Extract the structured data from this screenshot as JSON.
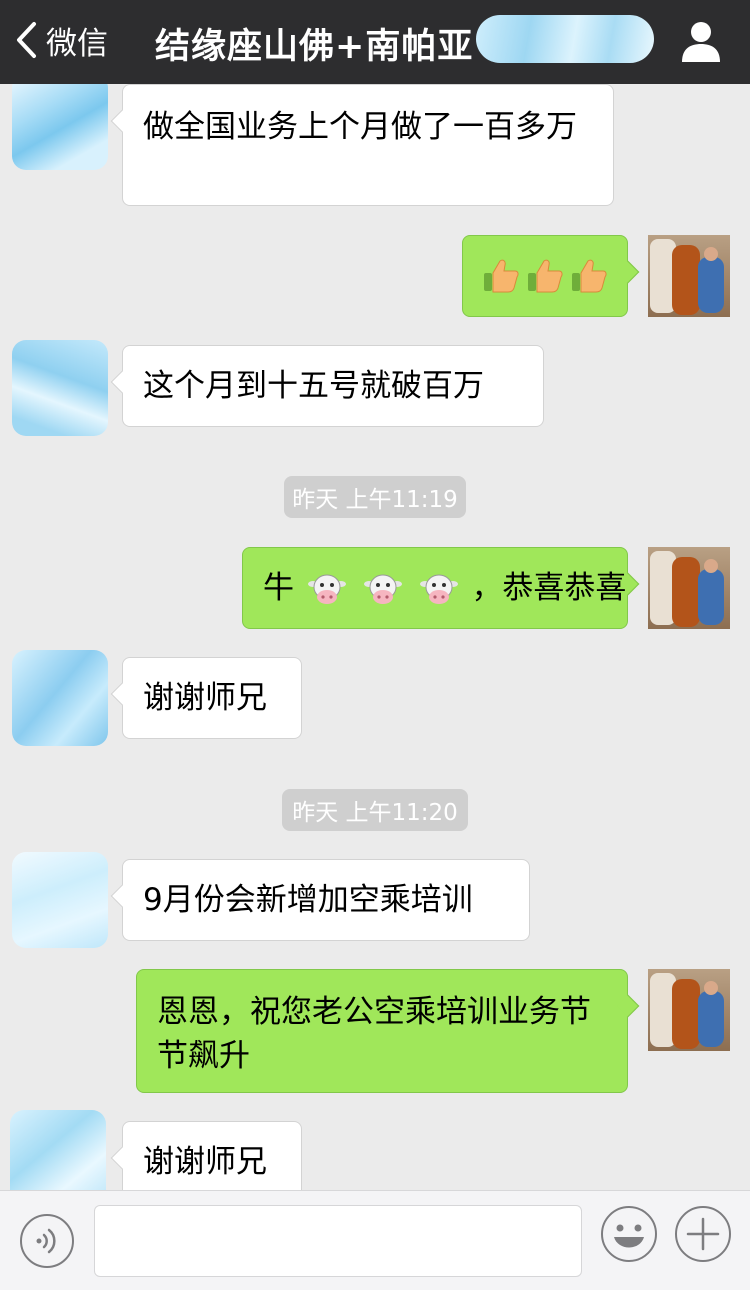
{
  "nav": {
    "back_label": "微信",
    "title": "结缘座山佛+南帕亚",
    "back_icon": "chevron-left-icon",
    "profile_icon": "person-icon"
  },
  "messages": [
    {
      "side": "left",
      "text": "做全国业务上个月做了一百多万"
    },
    {
      "side": "right",
      "emoji": "thumbs-up",
      "count": 3
    },
    {
      "side": "left",
      "text": "这个月到十五号就破百万"
    },
    {
      "side": "time",
      "text": "昨天 上午11:19"
    },
    {
      "side": "right",
      "prefix": "牛",
      "emoji": "cow-face",
      "count": 3,
      "suffix": "，恭喜恭喜"
    },
    {
      "side": "left",
      "text": "谢谢师兄"
    },
    {
      "side": "time",
      "text": "昨天 上午11:20"
    },
    {
      "side": "left",
      "text": "9月份会新增加空乘培训"
    },
    {
      "side": "right",
      "text": "恩恩，祝您老公空乘培训业务节节飙升"
    },
    {
      "side": "left",
      "text": "谢谢师兄"
    }
  ],
  "input": {
    "value": "",
    "placeholder": ""
  },
  "colors": {
    "navbar": "#2d2d2f",
    "chat_background": "#ebebeb",
    "sent_bubble": "#a0e75a",
    "received_bubble": "#ffffff",
    "timestamp_chip": "#cfcfcf"
  },
  "icons": {
    "voice": "voice-icon",
    "emoji": "smiley-icon",
    "plus": "plus-icon"
  }
}
